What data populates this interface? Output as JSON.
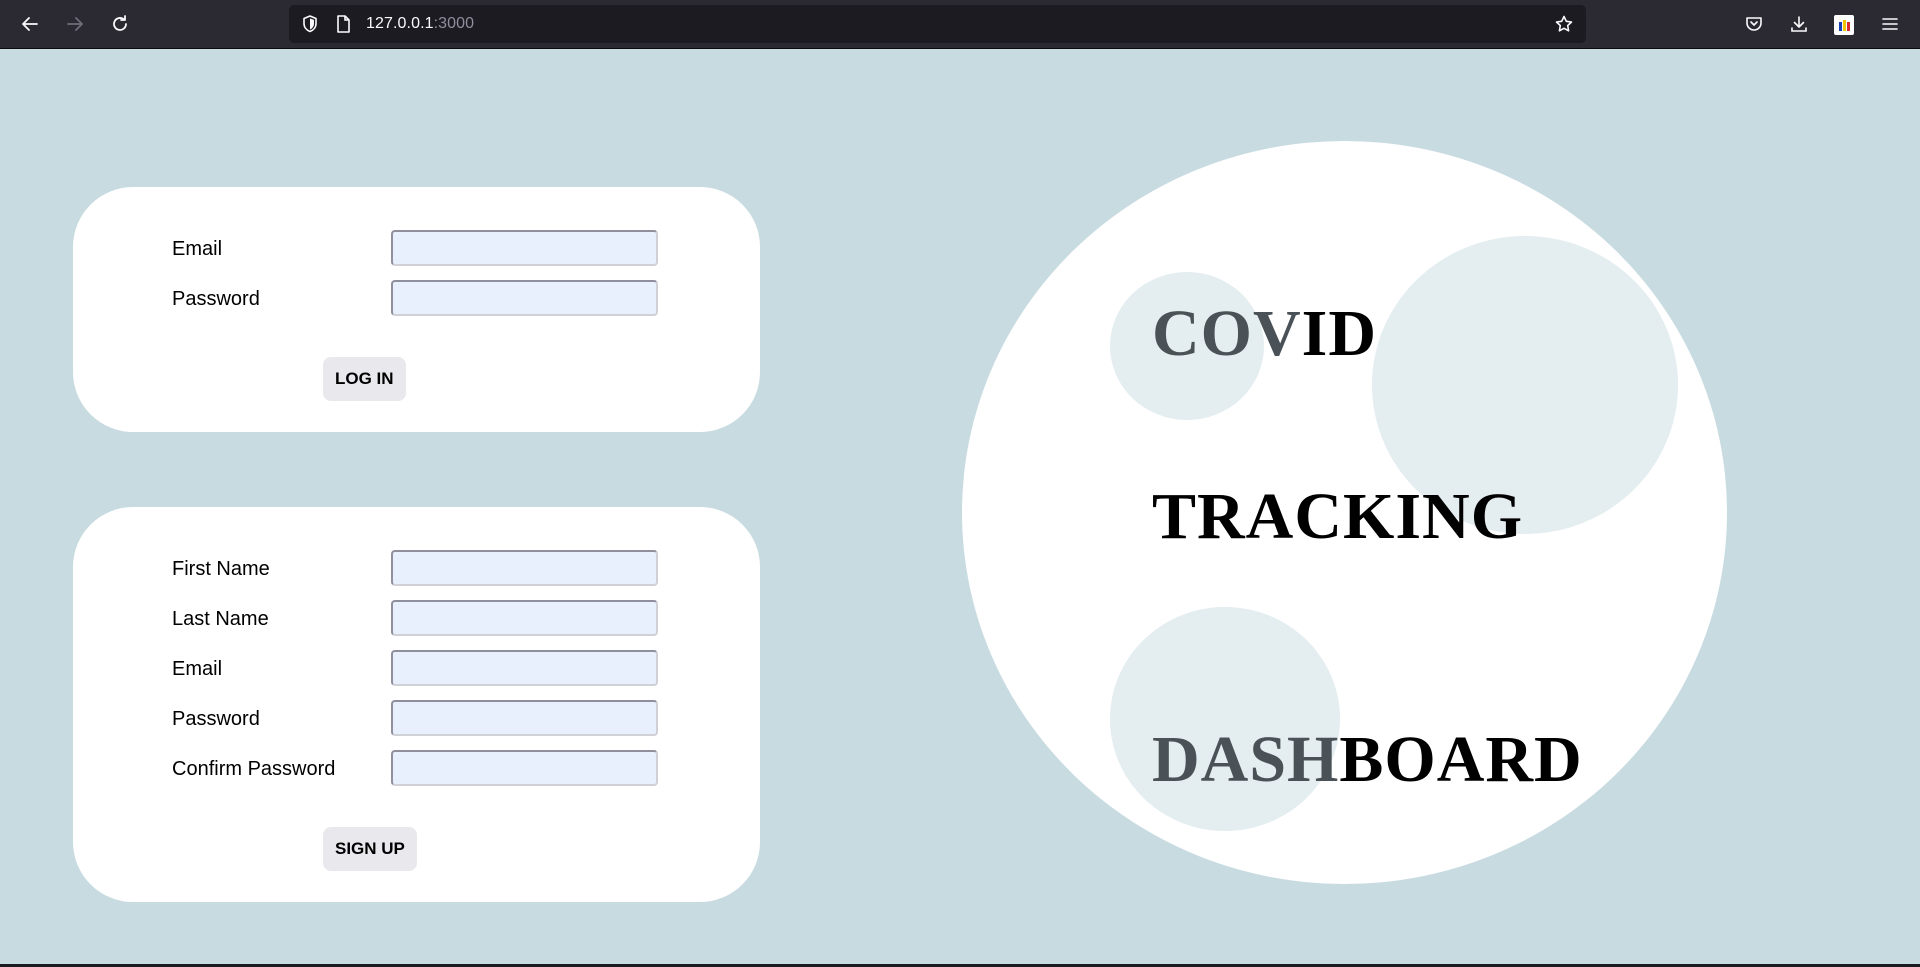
{
  "browser": {
    "url_host": "127.0.0.1",
    "url_port": ":3000",
    "icons": {
      "back": "back-arrow-icon",
      "forward": "forward-arrow-icon",
      "reload": "reload-icon",
      "shield": "tracking-protection-shield-icon",
      "page": "page-info-icon",
      "bookmark": "bookmark-star-icon",
      "pocket": "pocket-icon",
      "downloads": "downloads-icon",
      "extension": "extension-icon",
      "menu": "hamburger-menu-icon"
    }
  },
  "login": {
    "email_label": "Email",
    "password_label": "Password",
    "email_value": "",
    "password_value": "",
    "button_label": "LOG IN"
  },
  "signup": {
    "first_name_label": "First Name",
    "last_name_label": "Last Name",
    "email_label": "Email",
    "password_label": "Password",
    "confirm_password_label": "Confirm Password",
    "first_name_value": "",
    "last_name_value": "",
    "email_value": "",
    "password_value": "",
    "confirm_password_value": "",
    "button_label": "SIGN UP"
  },
  "hero": {
    "line1_a": "COV",
    "line1_b": "ID",
    "line2": "TRACKING",
    "line3_a": "DASH",
    "line3_b": "BOARD"
  },
  "colors": {
    "page_background": "#c8dbe1",
    "card_background": "#ffffff",
    "input_fill": "#e8f0fe",
    "bubble": "#e4edf0",
    "button": "#e9e9ed"
  }
}
